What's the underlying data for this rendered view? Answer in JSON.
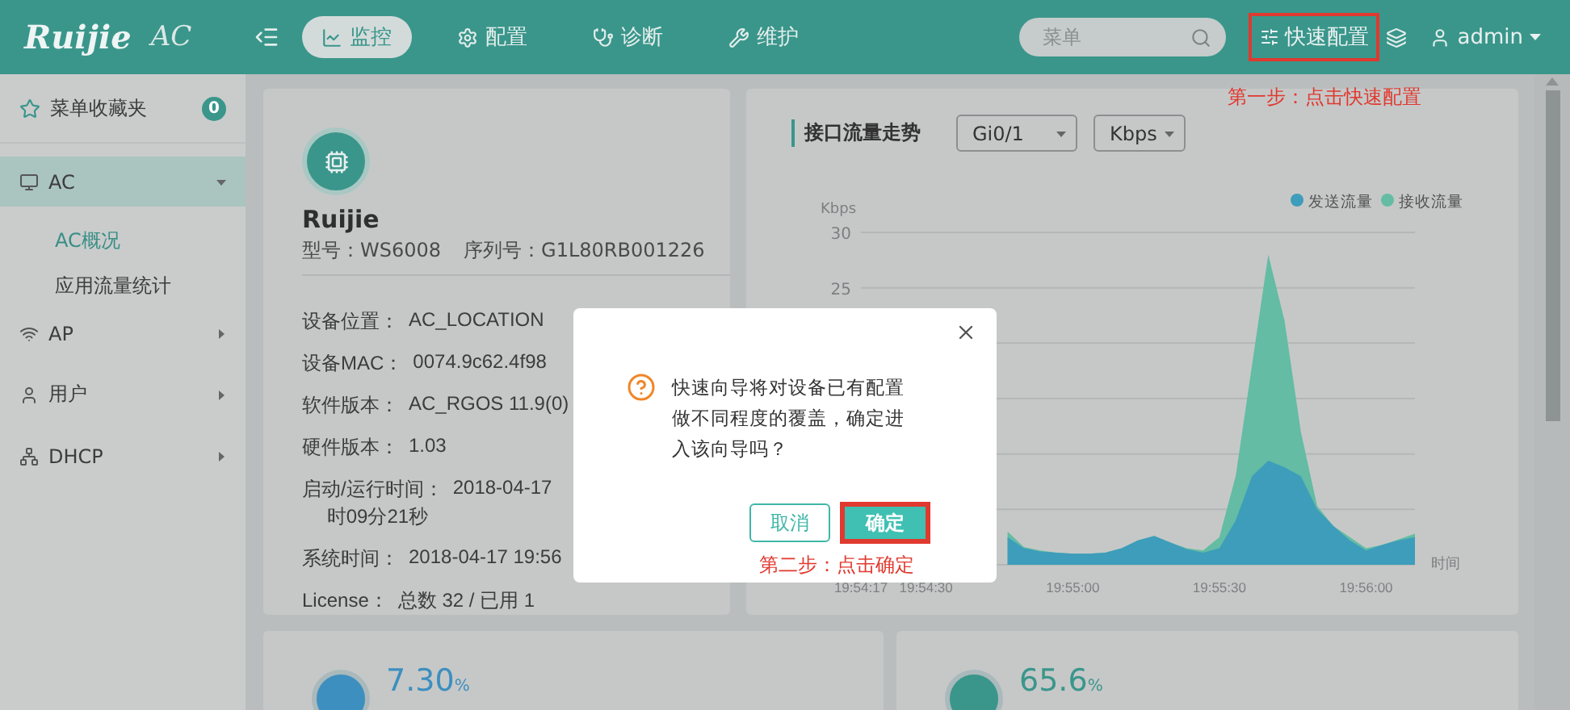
{
  "header": {
    "logo": "Ruijie",
    "product": "AC",
    "nav": [
      {
        "label": "监控",
        "selected": true
      },
      {
        "label": "配置",
        "selected": false
      },
      {
        "label": "诊断",
        "selected": false
      },
      {
        "label": "维护",
        "selected": false
      }
    ],
    "search": {
      "placeholder": "菜单"
    },
    "quick_config": {
      "label": "快速配置",
      "highlighted": true
    },
    "user": "admin"
  },
  "sidebar": {
    "favorites": {
      "label": "菜单收藏夹",
      "count": "0"
    },
    "items": [
      {
        "label": "AC",
        "expanded": true,
        "selected": true,
        "children": [
          {
            "label": "AC概况",
            "selected": true
          },
          {
            "label": "应用流量统计",
            "selected": false
          }
        ]
      },
      {
        "label": "AP",
        "expanded": false,
        "selected": false
      },
      {
        "label": "用户",
        "expanded": false,
        "selected": false
      },
      {
        "label": "DHCP",
        "expanded": false,
        "selected": false
      }
    ]
  },
  "device": {
    "name": "Ruijie",
    "model_label": "型号：WS6008",
    "serial_label": "序列号：G1L80RB001226",
    "rows": [
      {
        "label": "设备位置：",
        "lines": [
          "AC_LOCATION"
        ]
      },
      {
        "label": "设备MAC：",
        "lines": [
          "0074.9c62.4f98"
        ]
      },
      {
        "label": "软件版本：",
        "lines": [
          "AC_RGOS 11.9(0)"
        ]
      },
      {
        "label": "硬件版本：",
        "lines": [
          "1.03"
        ]
      },
      {
        "label": "启动/运行时间：",
        "lines": [
          "2018-04-17",
          "时09分21秒"
        ]
      },
      {
        "label": "系统时间：",
        "lines": [
          "2018-04-17 19:56"
        ]
      },
      {
        "label": "License：",
        "lines": [
          "总数 32 / 已用 1"
        ]
      }
    ]
  },
  "traffic": {
    "title": "接口流量走势",
    "interface": "Gi0/1",
    "unit": "Kbps",
    "chart_data": {
      "type": "area",
      "ylabel": "Kbps",
      "xlabel": "时间",
      "categories": [
        "19:54:17",
        null,
        null,
        null,
        "19:54:30",
        null,
        null,
        null,
        null,
        null,
        null,
        null,
        null,
        "19:55:00",
        null,
        null,
        null,
        null,
        null,
        null,
        null,
        null,
        "19:55:30",
        null,
        null,
        null,
        null,
        null,
        null,
        null,
        null,
        "19:56:00",
        null,
        null,
        null
      ],
      "series": [
        {
          "name": "发送流量",
          "color": "#3d9dbb",
          "values": [
            null,
            null,
            null,
            null,
            null,
            null,
            null,
            null,
            null,
            2.5,
            1.5,
            1.2,
            1.1,
            1,
            1,
            1.1,
            1.5,
            2.2,
            2.6,
            2,
            1.4,
            1.1,
            1.5,
            4,
            8,
            9.4,
            8.8,
            8,
            5,
            3.5,
            2.2,
            1.3,
            1.8,
            2.2,
            2.5
          ]
        },
        {
          "name": "接收流量",
          "color": "#63bca3",
          "values": [
            null,
            null,
            null,
            null,
            null,
            null,
            null,
            null,
            null,
            3,
            1.6,
            1.3,
            1.1,
            1,
            1,
            1.1,
            1.5,
            2.2,
            2.6,
            2,
            1.5,
            1.3,
            2.5,
            8,
            18,
            28,
            22,
            12,
            5.3,
            3.5,
            2.5,
            1.5,
            1.8,
            2.3,
            2.8
          ]
        }
      ],
      "ylim": [
        0,
        30
      ],
      "yticks": [
        25,
        30
      ],
      "legend": true
    }
  },
  "stats": [
    {
      "value": "7.30",
      "unit": "%",
      "color": "#3d8fbf"
    },
    {
      "value": "65.6",
      "unit": "%",
      "color": "#3a968b"
    }
  ],
  "dialog": {
    "message": "快速向导将对设备已有配置做不同程度的覆盖，确定进入该向导吗？",
    "cancel": "取消",
    "confirm": {
      "label": "确定",
      "highlighted": true
    }
  },
  "annotations": [
    {
      "kind": "step1",
      "text": "第一步：点击快速配置"
    },
    {
      "kind": "step2",
      "text": "第二步：点击确定"
    }
  ]
}
